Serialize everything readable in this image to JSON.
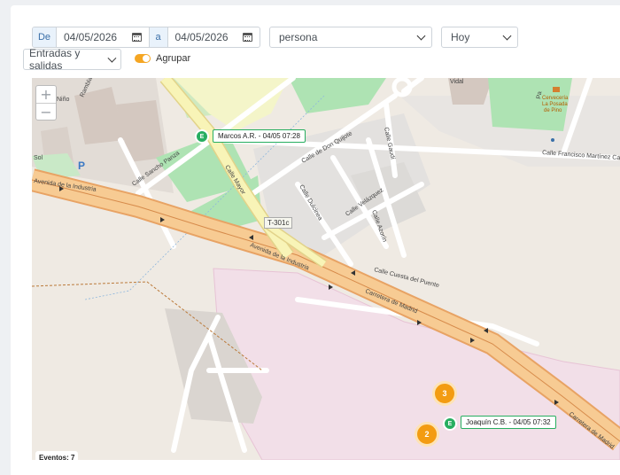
{
  "filters": {
    "from_prefix": "De",
    "from_date": "04/05/2026",
    "to_prefix": "a",
    "to_date": "04/05/2026",
    "person_select": "persona",
    "period_select": "Hoy",
    "type_select": "Entradas y salidas",
    "group_label": "Agrupar",
    "group_enabled": true
  },
  "map": {
    "zoom_in": "+",
    "zoom_out": "−",
    "markers": [
      {
        "code": "E",
        "label": "Marcos A.R. - 04/05 07:28"
      },
      {
        "code": "E",
        "label": "Joaquín C.B. - 04/05 07:32"
      }
    ],
    "clusters": [
      "3",
      "2"
    ],
    "road_tag": "T-301c",
    "parking": "P",
    "status": "Eventos: 7",
    "streets": {
      "industria_1": "Avenida de la Industria",
      "industria_2": "Avenida de la Industria",
      "madrid_1": "Carretera de Madrid",
      "madrid_2": "Carretera de Madrid",
      "sancho": "Calle Sancho Panza",
      "mayor": "Calle Mayor",
      "quijote": "Calle de Don Quijote",
      "dulcinea": "Calle Dulcinea",
      "velazquez": "Calle Velázquez",
      "azorin": "Calle Azorín",
      "gaudi": "Calle Gaudí",
      "cuesta": "Calle Cuesta del Puente",
      "francisco": "Calle Francisco Martínez Ca",
      "nino": "Niño",
      "rambla": "Rambla",
      "pa": "Pa",
      "vidal": "Vidal",
      "sol": "Sol"
    },
    "poi": {
      "line1": "Cervecería",
      "line2": "La Posada",
      "line3": "de Pino"
    }
  }
}
